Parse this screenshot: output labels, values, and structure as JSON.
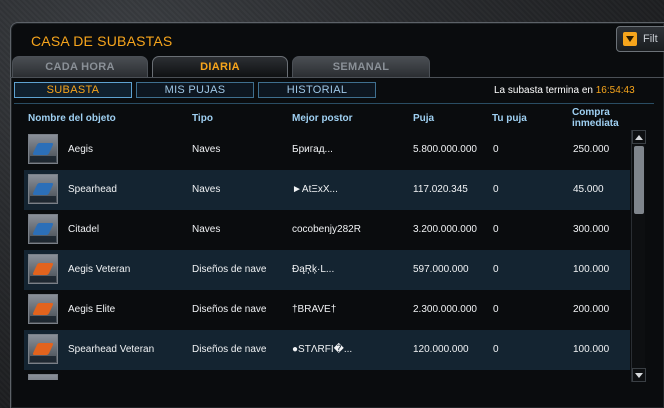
{
  "title": "CASA DE SUBASTAS",
  "filter": {
    "label": "Filt"
  },
  "period_tabs": [
    {
      "label": "CADA HORA",
      "active": false
    },
    {
      "label": "DIARIA",
      "active": true
    },
    {
      "label": "SEMANAL",
      "active": false
    }
  ],
  "sub_tabs": [
    {
      "label": "SUBASTA",
      "active": true
    },
    {
      "label": "MIS PUJAS",
      "active": false
    },
    {
      "label": "HISTORIAL",
      "active": false
    }
  ],
  "auction_end": {
    "label": "La subasta termina en",
    "time": "16:54:43"
  },
  "columns": {
    "name": "Nombre del objeto",
    "type": "Tipo",
    "bidder": "Mejor postor",
    "bid": "Puja",
    "your_bid": "Tu puja",
    "buy_now_line1": "Compra",
    "buy_now_line2": "inmediata"
  },
  "rows": [
    {
      "name": "Aegis",
      "type": "Naves",
      "bidder": "Бригад...",
      "bid": "5.800.000.000",
      "your_bid": "0",
      "buy_now": "250.000",
      "icon": "aegis-ship-icon",
      "design": false
    },
    {
      "name": "Spearhead",
      "type": "Naves",
      "bidder": "►AtΞxX...",
      "bid": "117.020.345",
      "your_bid": "0",
      "buy_now": "45.000",
      "icon": "spearhead-ship-icon",
      "design": false
    },
    {
      "name": "Citadel",
      "type": "Naves",
      "bidder": "cocobenjy282R",
      "bid": "3.200.000.000",
      "your_bid": "0",
      "buy_now": "300.000",
      "icon": "citadel-ship-icon",
      "design": false
    },
    {
      "name": "Aegis Veteran",
      "type": "Diseños de nave",
      "bidder": "ĐąŖķ·L...",
      "bid": "597.000.000",
      "your_bid": "0",
      "buy_now": "100.000",
      "icon": "aegis-design-icon",
      "design": true
    },
    {
      "name": "Aegis Elite",
      "type": "Diseños de nave",
      "bidder": "†BRAVE†",
      "bid": "2.300.000.000",
      "your_bid": "0",
      "buy_now": "200.000",
      "icon": "aegis-elite-design-icon",
      "design": true
    },
    {
      "name": "Spearhead Veteran",
      "type": "Diseños de nave",
      "bidder": "●STΛRFI�...",
      "bid": "120.000.000",
      "your_bid": "0",
      "buy_now": "100.000",
      "icon": "spearhead-design-icon",
      "design": true
    }
  ],
  "colors": {
    "accent": "#f7a51c",
    "header": "#9fd0f2",
    "row_alt": "#142431"
  }
}
